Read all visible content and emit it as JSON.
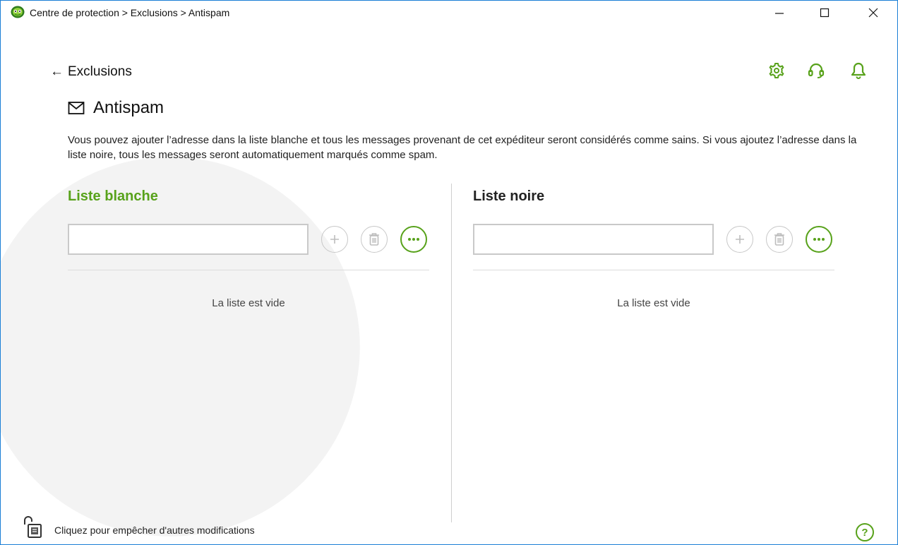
{
  "window": {
    "title": "Centre de protection > Exclusions > Antispam",
    "app_icon": "dr-web-spider-logo"
  },
  "header": {
    "back_label": "Exclusions",
    "toolbar_icons": [
      "gear-icon",
      "support-headset-icon",
      "bell-icon"
    ]
  },
  "page": {
    "icon": "envelope-icon",
    "title": "Antispam",
    "description": "Vous pouvez ajouter l’adresse dans la liste blanche et tous les messages provenant de cet expéditeur seront considérés comme sains. Si vous ajoutez l’adresse dans la liste noire, tous les messages seront automatiquement marqués comme spam."
  },
  "whitelist": {
    "title": "Liste blanche",
    "input_value": "",
    "empty_text": "La liste est vide"
  },
  "blacklist": {
    "title": "Liste noire",
    "input_value": "",
    "empty_text": "La liste est vide"
  },
  "footer": {
    "lock_text": "Cliquez pour empêcher d'autres modifications",
    "help_symbol": "?"
  },
  "colors": {
    "accent": "#58a21b",
    "window_border": "#1a7fd6",
    "disabled": "#c8c8c8"
  }
}
